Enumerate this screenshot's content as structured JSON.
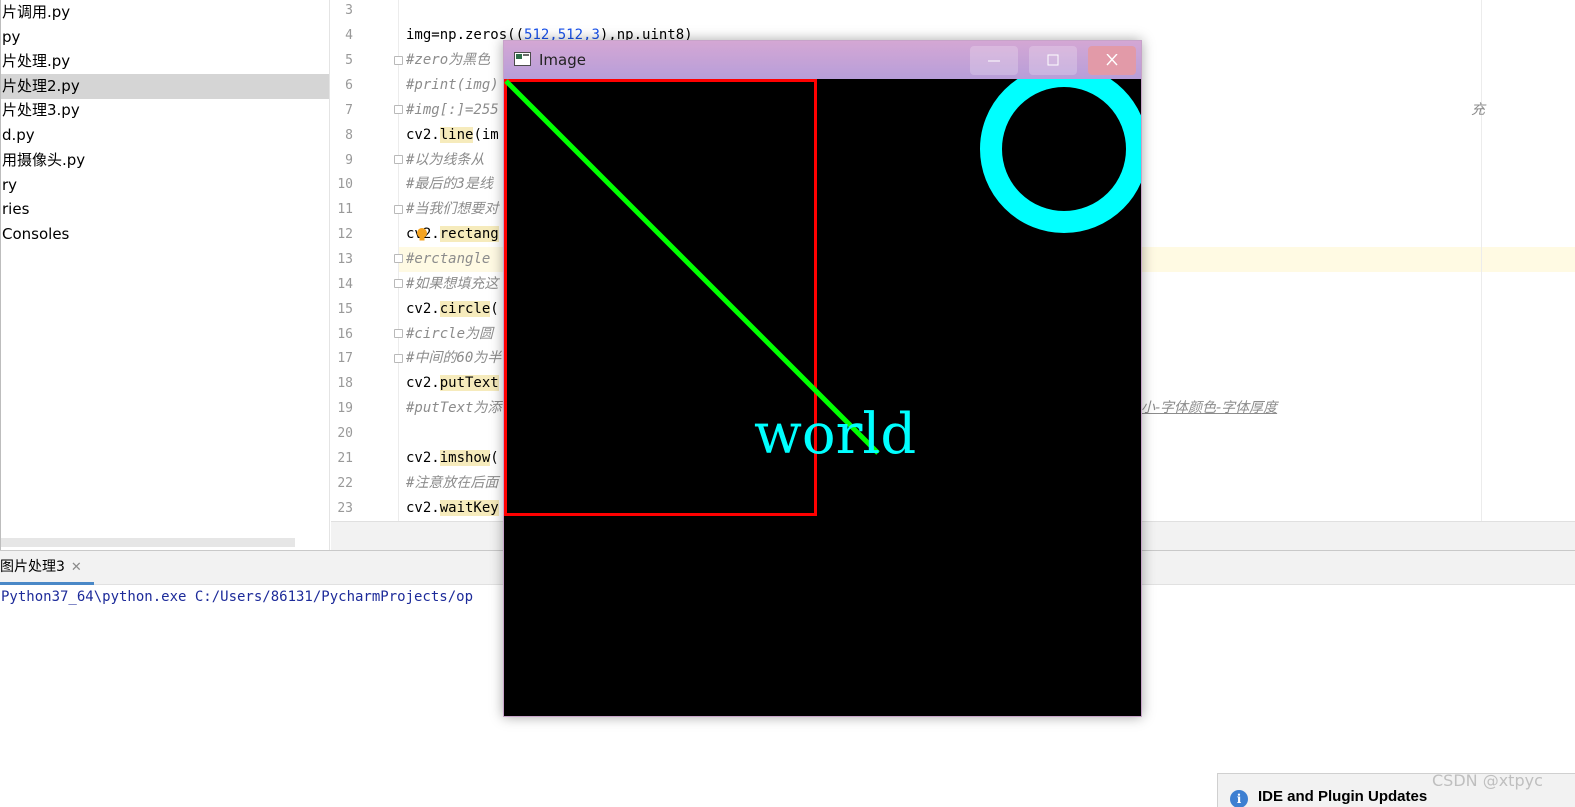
{
  "project_tree": {
    "items": [
      {
        "label": "片调用.py"
      },
      {
        "label": "py"
      },
      {
        "label": "片处理.py"
      },
      {
        "label": "片处理2.py",
        "selected": true
      },
      {
        "label": "片处理3.py"
      },
      {
        "label": "d.py"
      },
      {
        "label": "用摄像头.py"
      },
      {
        "label": "ry"
      },
      {
        "label": "ries"
      },
      {
        "label": " Consoles"
      }
    ]
  },
  "editor": {
    "line_numbers": [
      "3",
      "4",
      "5",
      "6",
      "7",
      "8",
      "9",
      "10",
      "11",
      "12",
      "13",
      "14",
      "15",
      "16",
      "17",
      "18",
      "19",
      "20",
      "21",
      "22",
      "23"
    ],
    "lines": {
      "l4_a": "img=np.zeros((",
      "l4_b": "512,512,3",
      "l4_c": "),np.uint8)",
      "l5": "#zero为黑色",
      "l6": "#print(img)",
      "l7": "#img[:]=255",
      "l8_a": "cv2.",
      "l8_b": "line",
      "l8_c": "(im",
      "l9": "#以为线条从",
      "l10": "#最后的3是线",
      "l11": "#当我们想要对",
      "l12_a": "cv2.",
      "l12_b": "rectang",
      "l13": "#erctangle",
      "l14": "#如果想填充这",
      "l15_a": "cv2.",
      "l15_b": "circle",
      "l15_c": "(",
      "l16": "#circle为圆",
      "l17": "#中间的60为半",
      "l18_a": "cv2.",
      "l18_b": "putText",
      "l19": "#putText为添",
      "l21_a": "cv2.",
      "l21_b": "imshow",
      "l21_c": "(",
      "l22": "#注意放在后面",
      "l23_a": "cv2.",
      "l23_b": "waitKey"
    },
    "overflow_l7": "充",
    "overflow_l19": "小-字体颜色-字体厚度"
  },
  "run_panel": {
    "tab_label": "图片处理3",
    "console_line": "Python37_64\\python.exe C:/Users/86131/PycharmProjects/op"
  },
  "cv_window": {
    "title": "Image",
    "image_text": "world",
    "colors": {
      "rectangle": "#ff0000",
      "line": "#00ff00",
      "circle": "#00ffff",
      "text": "#00ffff"
    }
  },
  "notification": {
    "title": "IDE and Plugin Updates"
  },
  "watermark": "CSDN @xtpyc"
}
